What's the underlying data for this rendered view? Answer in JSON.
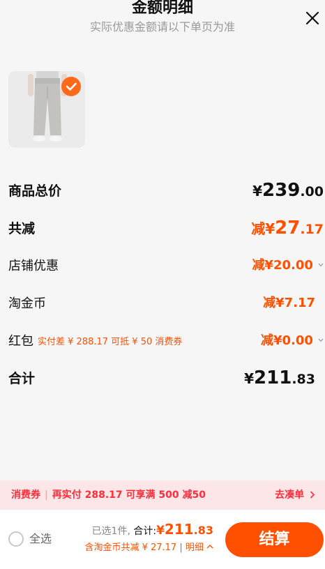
{
  "header": {
    "title": "金额明细",
    "subtitle": "实际优惠金额请以下单页为准"
  },
  "product": {
    "thumbnail_icon": "pants-image",
    "selected_icon": "check-icon"
  },
  "breakdown": {
    "total": {
      "label": "商品总价",
      "currency": "¥",
      "int": "239",
      "dec": ".00"
    },
    "reduction": {
      "label": "共减",
      "prefix": "减",
      "currency": "¥",
      "int": "27",
      "dec": ".17"
    },
    "shop_discount": {
      "label": "店铺优惠",
      "value": "减¥20.00"
    },
    "taobao_coins": {
      "label": "淘金币",
      "value": "减¥7.17"
    },
    "red_packet": {
      "label": "红包",
      "hint": "实付差 ¥ 288.17 可抵 ¥ 50 消费券",
      "value": "减¥0.00"
    },
    "sum": {
      "label": "合计",
      "currency": "¥",
      "int": "211",
      "dec": ".83"
    }
  },
  "promo": {
    "tag": "消费券",
    "text": "再实付 288.17 可享满 500 减50",
    "action": "去凑单"
  },
  "bottom_bar": {
    "select_all": "全选",
    "selected_count": "已选1件,",
    "total_label": "合计:",
    "total_currency": "¥",
    "total_int": "211",
    "total_dec": ".83",
    "coin_note": "含淘金币共减 ¥ 27.17 | 明细",
    "checkout": "结算"
  },
  "colors": {
    "accent": "#ff5000",
    "promo_bg": "#fde6e8",
    "promo_text": "#ff2d3a"
  }
}
